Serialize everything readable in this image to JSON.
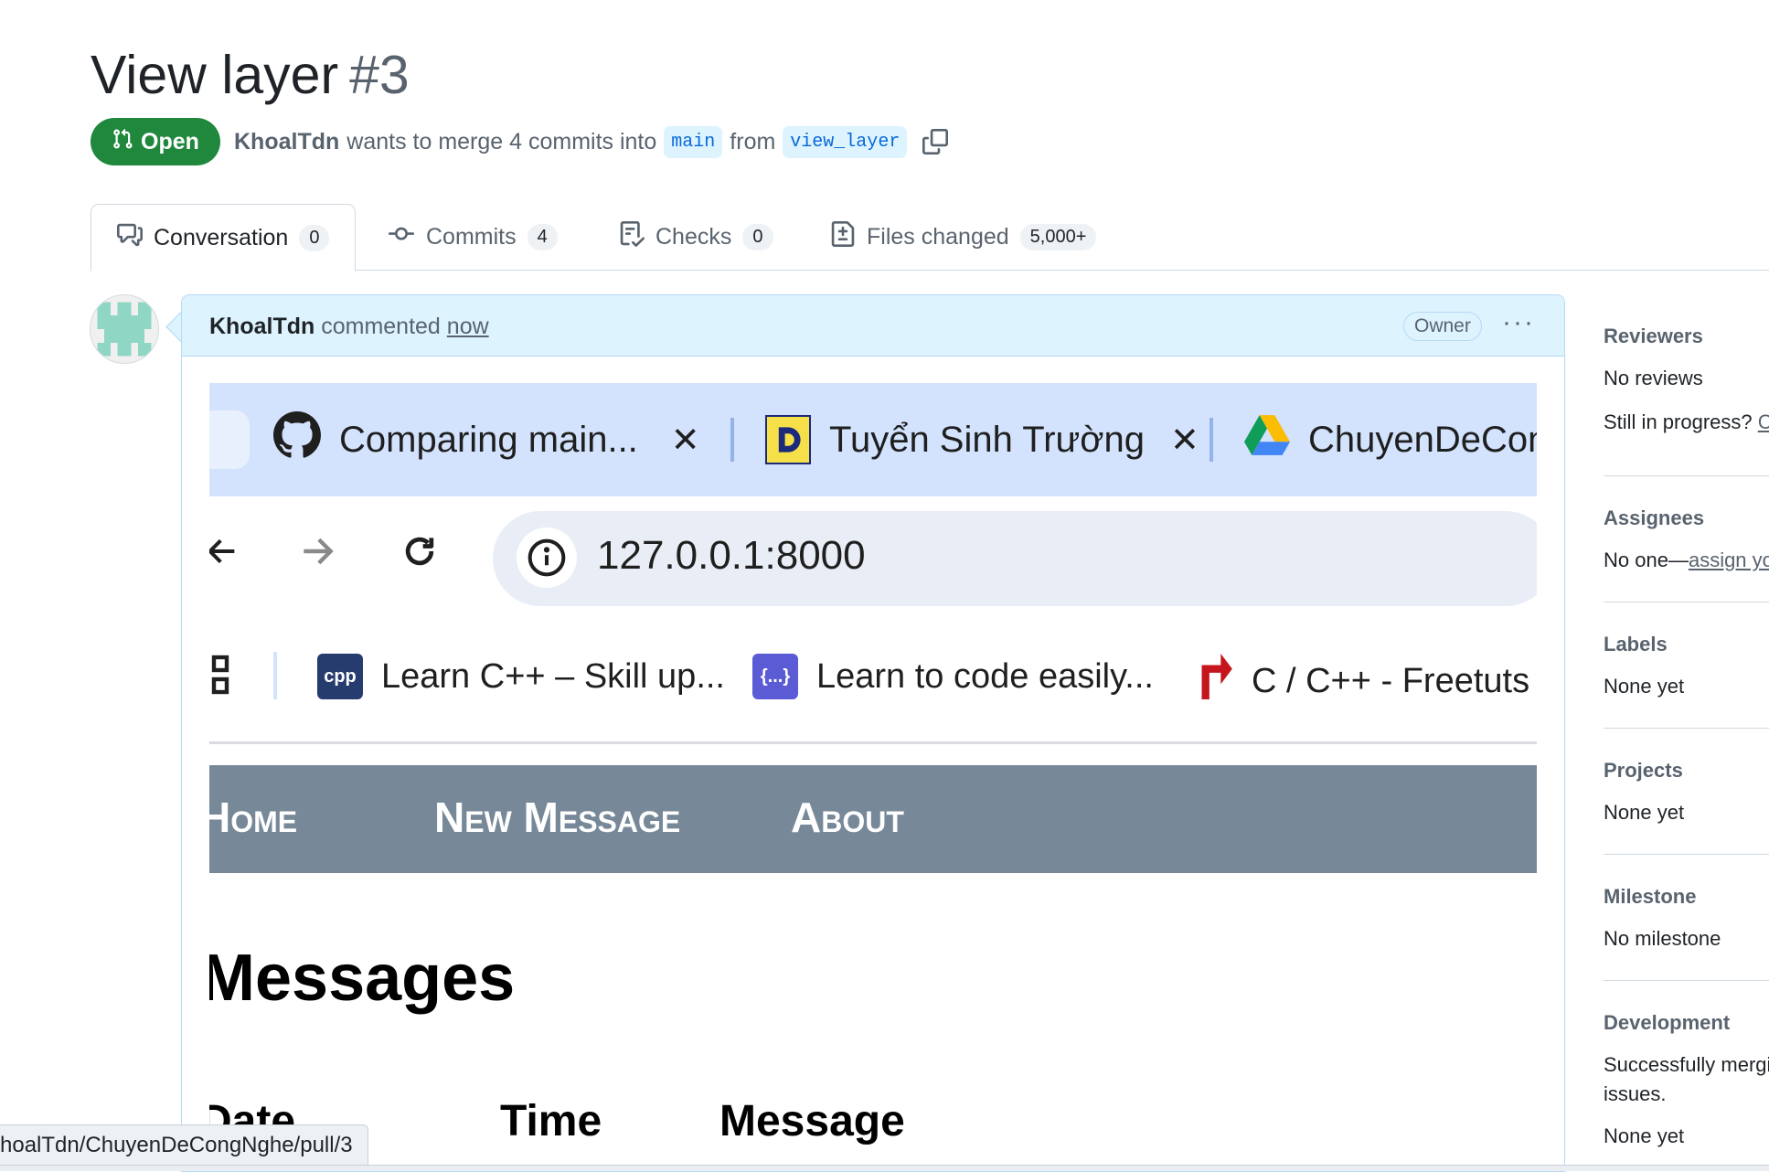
{
  "pr": {
    "title": "View layer",
    "number": "#3",
    "state": "Open",
    "author": "KhoalTdn",
    "merge_text": "wants to merge 4 commits into",
    "base_branch": "main",
    "from_text": "from",
    "head_branch": "view_layer"
  },
  "tabs": [
    {
      "label": "Conversation",
      "count": "0"
    },
    {
      "label": "Commits",
      "count": "4"
    },
    {
      "label": "Checks",
      "count": "0"
    },
    {
      "label": "Files changed",
      "count": "5,000+"
    }
  ],
  "comment": {
    "author": "KhoalTdn",
    "action": "commented",
    "time": "now",
    "role": "Owner",
    "menu": "···"
  },
  "screenshot": {
    "browser_tabs": [
      {
        "title": "Comparing main...",
        "close": "✕"
      },
      {
        "title": "Tuyển Sinh Trường",
        "close": "✕"
      },
      {
        "title": "ChuyenDeCong"
      }
    ],
    "url": "127.0.0.1:8000",
    "bookmarks": [
      {
        "label": "Learn C++ – Skill up...",
        "icon_text": "cpp"
      },
      {
        "label": "Learn to code easily...",
        "icon_text": "{...}"
      },
      {
        "label": "C / C++ - Freetuts"
      }
    ],
    "site_nav": [
      "Home",
      "New Message",
      "About"
    ],
    "heading": "Messages",
    "columns": [
      "Date",
      "Time",
      "Message"
    ]
  },
  "sidebar": {
    "reviewers": {
      "heading": "Reviewers",
      "value": "No reviews",
      "extra_prefix": "Still in progress?",
      "extra_link": "Co"
    },
    "assignees": {
      "heading": "Assignees",
      "value_prefix": "No one—",
      "value_link": "assign yo"
    },
    "labels": {
      "heading": "Labels",
      "value": "None yet"
    },
    "projects": {
      "heading": "Projects",
      "value": "None yet"
    },
    "milestone": {
      "heading": "Milestone",
      "value": "No milestone"
    },
    "development": {
      "heading": "Development",
      "line1": "Successfully mergin",
      "line2": "issues.",
      "value": "None yet"
    }
  },
  "status_url": "hoalTdn/ChuyenDeCongNghe/pull/3",
  "colors": {
    "open_green": "#1f883d",
    "accent_blue": "#0969da",
    "comment_header": "#ddf4ff",
    "site_nav": "#778899"
  }
}
